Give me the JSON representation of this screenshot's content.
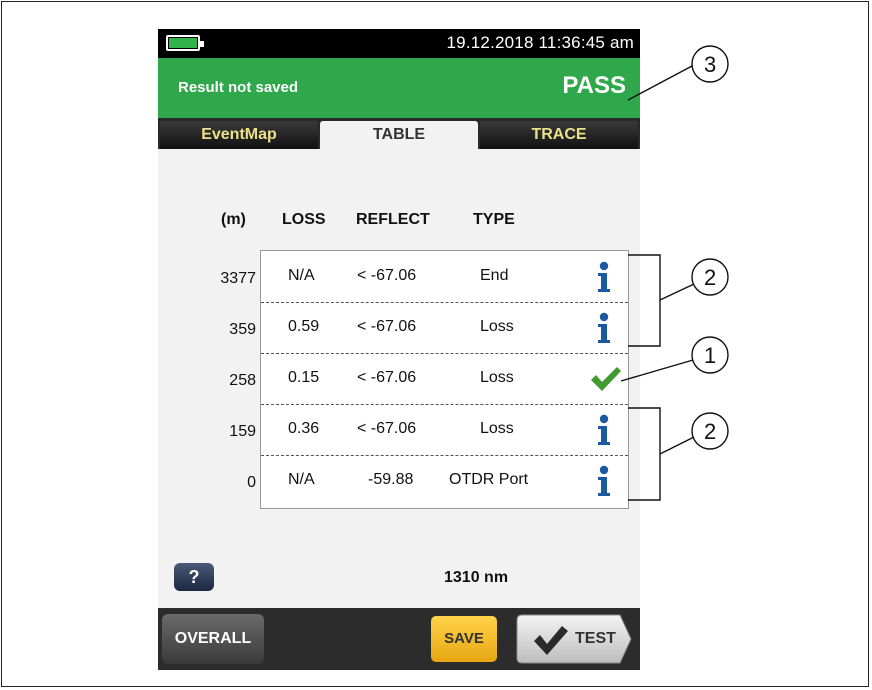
{
  "status_bar": {
    "datetime": "19.12.2018 11:36:45 am"
  },
  "result_header": {
    "save_status": "Result not saved",
    "verdict": "PASS",
    "color": "#2ea84a"
  },
  "tabs": [
    {
      "label": "EventMap",
      "active": false
    },
    {
      "label": "TABLE",
      "active": true
    },
    {
      "label": "TRACE",
      "active": false
    }
  ],
  "table": {
    "headers": {
      "distance": "(m)",
      "loss": "LOSS",
      "reflect": "REFLECT",
      "type": "TYPE"
    },
    "rows": [
      {
        "distance": "3377",
        "loss": "N/A",
        "reflect": "< -67.06",
        "type": "End",
        "icon": "info-icon"
      },
      {
        "distance": "359",
        "loss": "0.59",
        "reflect": "< -67.06",
        "type": "Loss",
        "icon": "info-icon"
      },
      {
        "distance": "258",
        "loss": "0.15",
        "reflect": "< -67.06",
        "type": "Loss",
        "icon": "check-icon"
      },
      {
        "distance": "159",
        "loss": "0.36",
        "reflect": "< -67.06",
        "type": "Loss",
        "icon": "info-icon"
      },
      {
        "distance": "0",
        "loss": "N/A",
        "reflect": "-59.88",
        "type": "OTDR Port",
        "icon": "info-icon"
      }
    ]
  },
  "help_button": {
    "label": "?"
  },
  "wavelength": "1310 nm",
  "bottom_bar": {
    "overall_label": "OVERALL",
    "save_label": "SAVE",
    "test_label": "TEST"
  },
  "callouts": {
    "c1": "1",
    "c2a": "2",
    "c2b": "2",
    "c3": "3"
  }
}
